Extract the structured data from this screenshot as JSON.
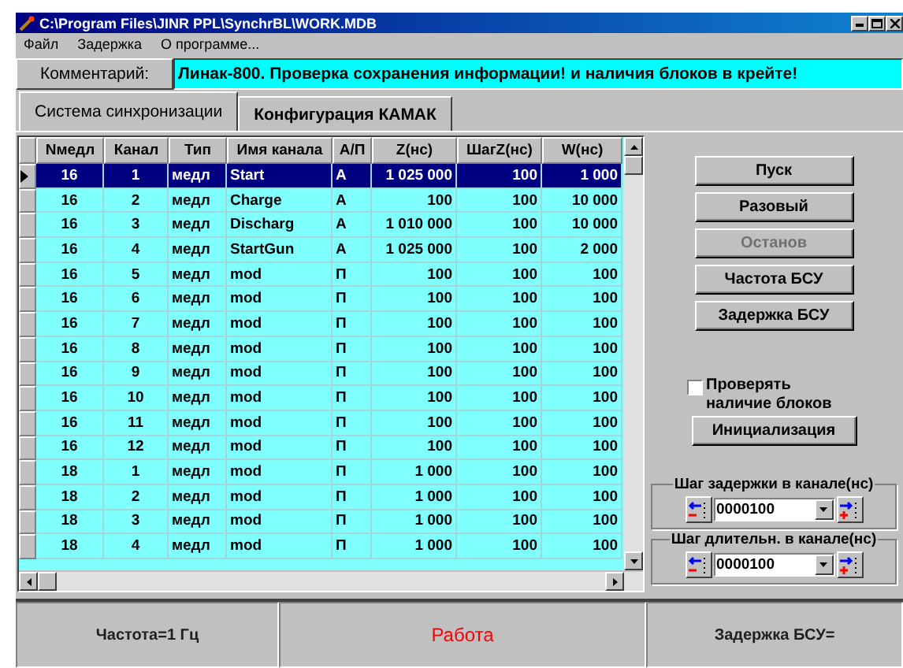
{
  "window": {
    "title": "C:\\Program Files\\JINR PPL\\SynchrBL\\WORK.MDB"
  },
  "menu": [
    "Файл",
    "Задержка",
    "О программе..."
  ],
  "comment": {
    "label": "Комментарий:",
    "value": "Линак-800. Проверка сохранения информации! и наличия блоков в крейте!"
  },
  "tabs": [
    {
      "label": "Система синхронизации",
      "selected": true
    },
    {
      "label": "Конфигурация КАМАК",
      "selected": false
    }
  ],
  "table": {
    "columns": [
      "Nмедл",
      "Канал",
      "Тип",
      "Имя канала",
      "А/П",
      "Z(нс)",
      "ШагZ(нс)",
      "W(нс)"
    ],
    "rows": [
      {
        "selected": true,
        "cells": [
          "16",
          "1",
          "медл",
          "Start",
          "А",
          "1 025 000",
          "100",
          "1 000"
        ]
      },
      {
        "selected": false,
        "cells": [
          "16",
          "2",
          "медл",
          "Charge",
          "А",
          "100",
          "100",
          "10 000"
        ]
      },
      {
        "selected": false,
        "cells": [
          "16",
          "3",
          "медл",
          "Discharg",
          "А",
          "1 010 000",
          "100",
          "10 000"
        ]
      },
      {
        "selected": false,
        "cells": [
          "16",
          "4",
          "медл",
          "StartGun",
          "А",
          "1 025 000",
          "100",
          "2 000"
        ]
      },
      {
        "selected": false,
        "cells": [
          "16",
          "5",
          "медл",
          "mod",
          "П",
          "100",
          "100",
          "100"
        ]
      },
      {
        "selected": false,
        "cells": [
          "16",
          "6",
          "медл",
          "mod",
          "П",
          "100",
          "100",
          "100"
        ]
      },
      {
        "selected": false,
        "cells": [
          "16",
          "7",
          "медл",
          "mod",
          "П",
          "100",
          "100",
          "100"
        ]
      },
      {
        "selected": false,
        "cells": [
          "16",
          "8",
          "медл",
          "mod",
          "П",
          "100",
          "100",
          "100"
        ]
      },
      {
        "selected": false,
        "cells": [
          "16",
          "9",
          "медл",
          "mod",
          "П",
          "100",
          "100",
          "100"
        ]
      },
      {
        "selected": false,
        "cells": [
          "16",
          "10",
          "медл",
          "mod",
          "П",
          "100",
          "100",
          "100"
        ]
      },
      {
        "selected": false,
        "cells": [
          "16",
          "11",
          "медл",
          "mod",
          "П",
          "100",
          "100",
          "100"
        ]
      },
      {
        "selected": false,
        "cells": [
          "16",
          "12",
          "медл",
          "mod",
          "П",
          "100",
          "100",
          "100"
        ]
      },
      {
        "selected": false,
        "cells": [
          "18",
          "1",
          "медл",
          "mod",
          "П",
          "1 000",
          "100",
          "100"
        ]
      },
      {
        "selected": false,
        "cells": [
          "18",
          "2",
          "медл",
          "mod",
          "П",
          "1 000",
          "100",
          "100"
        ]
      },
      {
        "selected": false,
        "cells": [
          "18",
          "3",
          "медл",
          "mod",
          "П",
          "1 000",
          "100",
          "100"
        ]
      },
      {
        "selected": false,
        "cells": [
          "18",
          "4",
          "медл",
          "mod",
          "П",
          "1 000",
          "100",
          "100"
        ]
      }
    ]
  },
  "buttons": [
    {
      "label": "Пуск",
      "disabled": false
    },
    {
      "label": "Разовый",
      "disabled": false
    },
    {
      "label": "Останов",
      "disabled": true
    },
    {
      "label": "Частота БСУ",
      "disabled": false
    },
    {
      "label": "Задержка БСУ",
      "disabled": false
    }
  ],
  "check": {
    "label": "Проверять наличие блоков",
    "checked": false
  },
  "init_button": "Инициализация",
  "steps": [
    {
      "label": "Шаг задержки в канале(нс)",
      "value": "0000100"
    },
    {
      "label": "Шаг длительн. в канале(нс)",
      "value": "0000100"
    }
  ],
  "status_bar": [
    {
      "text": "Частота=1 Гц",
      "kind": "normal"
    },
    {
      "text": "Работа",
      "kind": "alert"
    },
    {
      "text": "Задержка БСУ=",
      "kind": "normal"
    }
  ]
}
